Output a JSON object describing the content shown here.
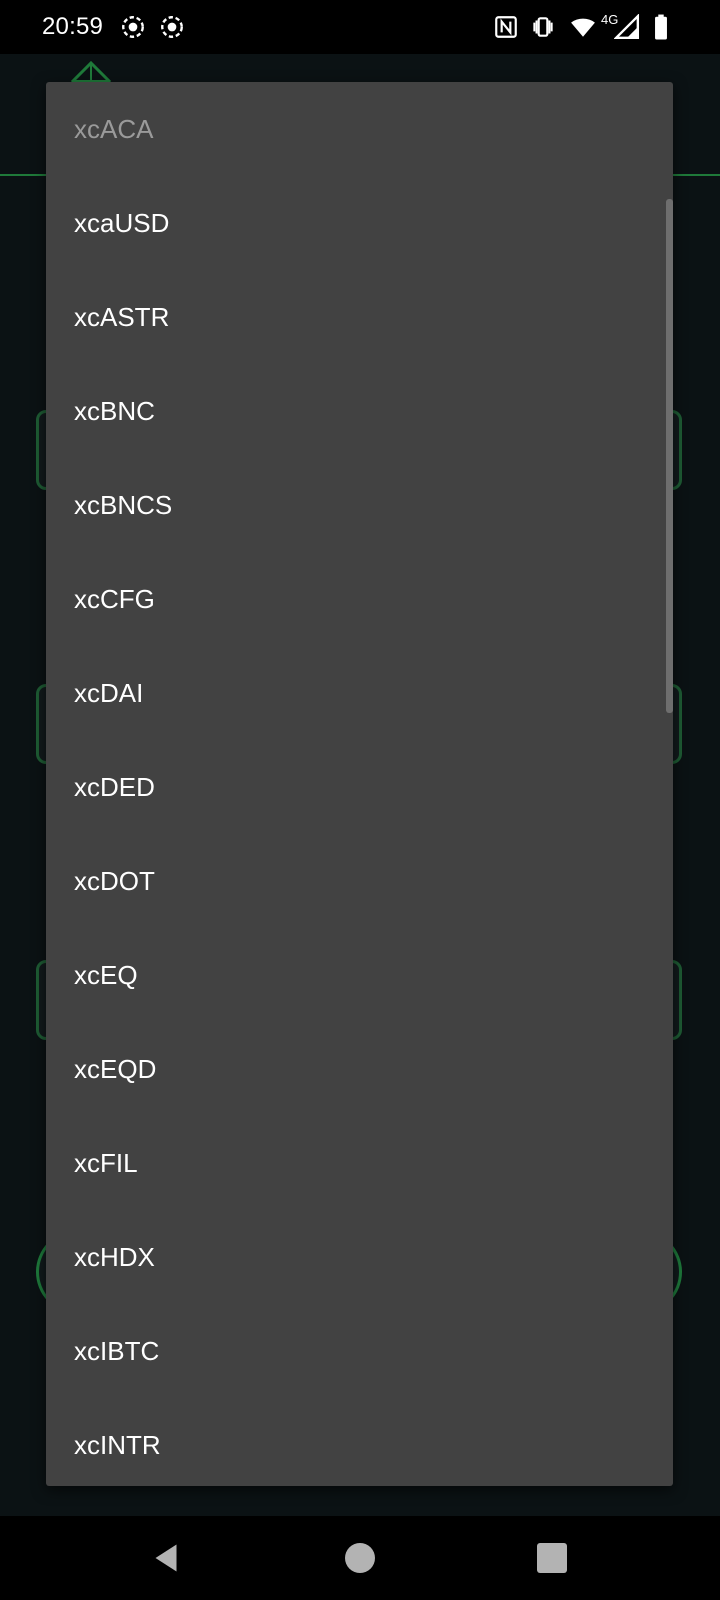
{
  "status_bar": {
    "time": "20:59",
    "network_label": "4G",
    "icons": [
      "screen-record-icon",
      "screen-record-icon",
      "nfc-icon",
      "vibrate-icon",
      "wifi-icon",
      "cell-signal-icon",
      "battery-icon"
    ]
  },
  "colors": {
    "accent": "#1f7a3a",
    "popup_background": "#424242",
    "selected_text": "#9a9a9a",
    "item_text": "#ffffff"
  },
  "dropdown": {
    "selected": "xcACA",
    "items": [
      {
        "label": "xcACA",
        "selected": true
      },
      {
        "label": "xcaUSD",
        "selected": false
      },
      {
        "label": "xcASTR",
        "selected": false
      },
      {
        "label": "xcBNC",
        "selected": false
      },
      {
        "label": "xcBNCS",
        "selected": false
      },
      {
        "label": "xcCFG",
        "selected": false
      },
      {
        "label": "xcDAI",
        "selected": false
      },
      {
        "label": "xcDED",
        "selected": false
      },
      {
        "label": "xcDOT",
        "selected": false
      },
      {
        "label": "xcEQ",
        "selected": false
      },
      {
        "label": "xcEQD",
        "selected": false
      },
      {
        "label": "xcFIL",
        "selected": false
      },
      {
        "label": "xcHDX",
        "selected": false
      },
      {
        "label": "xcIBTC",
        "selected": false
      },
      {
        "label": "xcINTR",
        "selected": false
      }
    ]
  },
  "nav_bar": {
    "icons": [
      "back-icon",
      "home-icon",
      "recents-icon"
    ]
  }
}
